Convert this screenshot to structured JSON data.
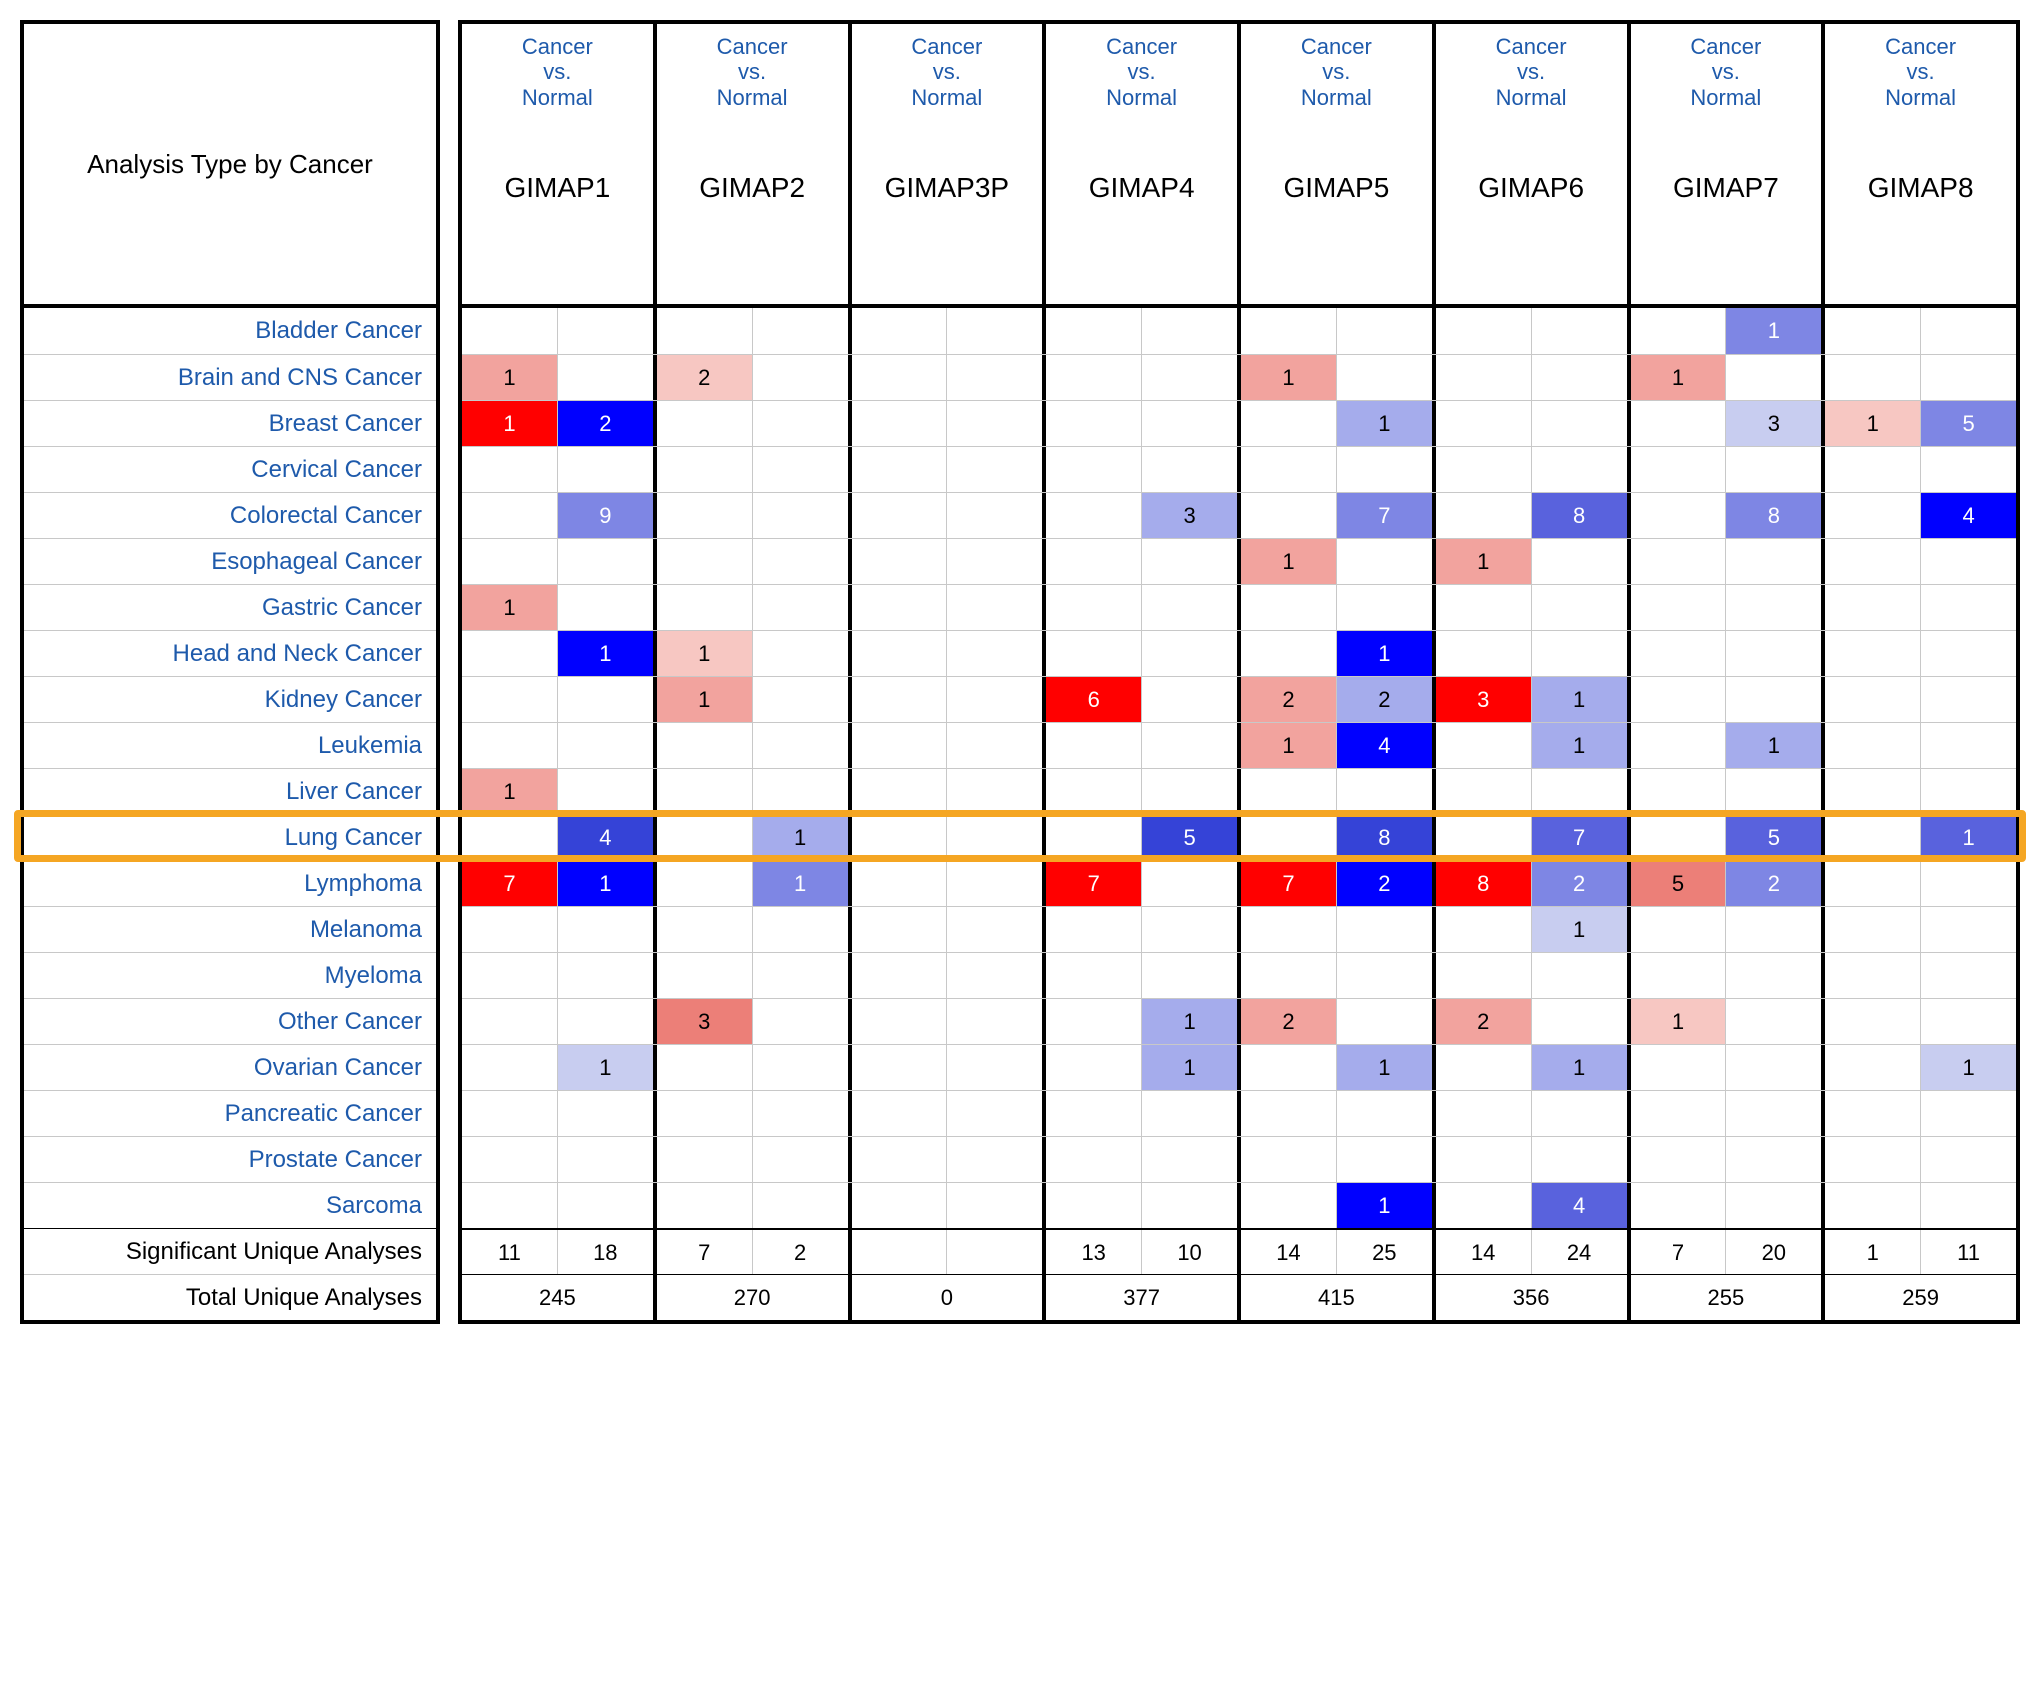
{
  "chart_data": {
    "type": "table",
    "title": "Analysis Type by Cancer",
    "column_header_top": "Cancer vs. Normal",
    "genes": [
      "GIMAP1",
      "GIMAP2",
      "GIMAP3P",
      "GIMAP4",
      "GIMAP5",
      "GIMAP6",
      "GIMAP7",
      "GIMAP8"
    ],
    "cancers": [
      "Bladder Cancer",
      "Brain and CNS Cancer",
      "Breast Cancer",
      "Cervical Cancer",
      "Colorectal Cancer",
      "Esophageal Cancer",
      "Gastric Cancer",
      "Head and Neck Cancer",
      "Kidney Cancer",
      "Leukemia",
      "Liver Cancer",
      "Lung Cancer",
      "Lymphoma",
      "Melanoma",
      "Myeloma",
      "Other Cancer",
      "Ovarian Cancer",
      "Pancreatic Cancer",
      "Prostate Cancer",
      "Sarcoma"
    ],
    "highlight_row": "Lung Cancer",
    "cells": {
      "Bladder Cancer": {
        "GIMAP7": {
          "down": {
            "v": 1,
            "s": 3
          }
        }
      },
      "Brain and CNS Cancer": {
        "GIMAP1": {
          "up": {
            "v": 1,
            "s": 2
          }
        },
        "GIMAP2": {
          "up": {
            "v": 2,
            "s": 1
          }
        },
        "GIMAP5": {
          "up": {
            "v": 1,
            "s": 2
          }
        },
        "GIMAP7": {
          "up": {
            "v": 1,
            "s": 2
          }
        }
      },
      "Breast Cancer": {
        "GIMAP1": {
          "up": {
            "v": 1,
            "s": 6
          },
          "down": {
            "v": 2,
            "s": 6
          }
        },
        "GIMAP5": {
          "down": {
            "v": 1,
            "s": 2
          }
        },
        "GIMAP7": {
          "down": {
            "v": 3,
            "s": 1
          }
        },
        "GIMAP8": {
          "up": {
            "v": 1,
            "s": 1
          },
          "down": {
            "v": 5,
            "s": 3
          }
        }
      },
      "Cervical Cancer": {},
      "Colorectal Cancer": {
        "GIMAP1": {
          "down": {
            "v": 9,
            "s": 3
          }
        },
        "GIMAP4": {
          "down": {
            "v": 3,
            "s": 2
          }
        },
        "GIMAP5": {
          "down": {
            "v": 7,
            "s": 3
          }
        },
        "GIMAP6": {
          "down": {
            "v": 8,
            "s": 4
          }
        },
        "GIMAP7": {
          "down": {
            "v": 8,
            "s": 3
          }
        },
        "GIMAP8": {
          "down": {
            "v": 4,
            "s": 6
          }
        }
      },
      "Esophageal Cancer": {
        "GIMAP5": {
          "up": {
            "v": 1,
            "s": 2
          }
        },
        "GIMAP6": {
          "up": {
            "v": 1,
            "s": 2
          }
        }
      },
      "Gastric Cancer": {
        "GIMAP1": {
          "up": {
            "v": 1,
            "s": 2
          }
        }
      },
      "Head and Neck Cancer": {
        "GIMAP1": {
          "down": {
            "v": 1,
            "s": 6
          }
        },
        "GIMAP2": {
          "up": {
            "v": 1,
            "s": 1
          }
        },
        "GIMAP5": {
          "down": {
            "v": 1,
            "s": 6
          }
        }
      },
      "Kidney Cancer": {
        "GIMAP2": {
          "up": {
            "v": 1,
            "s": 2
          }
        },
        "GIMAP4": {
          "up": {
            "v": 6,
            "s": 6
          }
        },
        "GIMAP5": {
          "up": {
            "v": 2,
            "s": 2
          },
          "down": {
            "v": 2,
            "s": 2
          }
        },
        "GIMAP6": {
          "up": {
            "v": 3,
            "s": 6
          },
          "down": {
            "v": 1,
            "s": 2
          }
        }
      },
      "Leukemia": {
        "GIMAP5": {
          "up": {
            "v": 1,
            "s": 2
          },
          "down": {
            "v": 4,
            "s": 6
          }
        },
        "GIMAP6": {
          "down": {
            "v": 1,
            "s": 2
          }
        },
        "GIMAP7": {
          "down": {
            "v": 1,
            "s": 2
          }
        }
      },
      "Liver Cancer": {
        "GIMAP1": {
          "up": {
            "v": 1,
            "s": 2
          }
        }
      },
      "Lung Cancer": {
        "GIMAP1": {
          "down": {
            "v": 4,
            "s": 5
          }
        },
        "GIMAP2": {
          "down": {
            "v": 1,
            "s": 2
          }
        },
        "GIMAP4": {
          "down": {
            "v": 5,
            "s": 5
          }
        },
        "GIMAP5": {
          "down": {
            "v": 8,
            "s": 5
          }
        },
        "GIMAP6": {
          "down": {
            "v": 7,
            "s": 4
          }
        },
        "GIMAP7": {
          "down": {
            "v": 5,
            "s": 4
          }
        },
        "GIMAP8": {
          "down": {
            "v": 1,
            "s": 4
          }
        }
      },
      "Lymphoma": {
        "GIMAP1": {
          "up": {
            "v": 7,
            "s": 6
          },
          "down": {
            "v": 1,
            "s": 6
          }
        },
        "GIMAP2": {
          "down": {
            "v": 1,
            "s": 3
          }
        },
        "GIMAP4": {
          "up": {
            "v": 7,
            "s": 6
          }
        },
        "GIMAP5": {
          "up": {
            "v": 7,
            "s": 6
          },
          "down": {
            "v": 2,
            "s": 6
          }
        },
        "GIMAP6": {
          "up": {
            "v": 8,
            "s": 6
          },
          "down": {
            "v": 2,
            "s": 3
          }
        },
        "GIMAP7": {
          "up": {
            "v": 5,
            "s": 3
          },
          "down": {
            "v": 2,
            "s": 3
          }
        }
      },
      "Melanoma": {
        "GIMAP6": {
          "down": {
            "v": 1,
            "s": 1
          }
        }
      },
      "Myeloma": {},
      "Other Cancer": {
        "GIMAP2": {
          "up": {
            "v": 3,
            "s": 3
          }
        },
        "GIMAP4": {
          "down": {
            "v": 1,
            "s": 2
          }
        },
        "GIMAP5": {
          "up": {
            "v": 2,
            "s": 2
          }
        },
        "GIMAP6": {
          "up": {
            "v": 2,
            "s": 2
          }
        },
        "GIMAP7": {
          "up": {
            "v": 1,
            "s": 1
          }
        }
      },
      "Ovarian Cancer": {
        "GIMAP1": {
          "down": {
            "v": 1,
            "s": 1
          }
        },
        "GIMAP4": {
          "down": {
            "v": 1,
            "s": 2
          }
        },
        "GIMAP5": {
          "down": {
            "v": 1,
            "s": 2
          }
        },
        "GIMAP6": {
          "down": {
            "v": 1,
            "s": 2
          }
        },
        "GIMAP8": {
          "down": {
            "v": 1,
            "s": 1
          }
        }
      },
      "Pancreatic Cancer": {},
      "Prostate Cancer": {},
      "Sarcoma": {
        "GIMAP5": {
          "down": {
            "v": 1,
            "s": 6
          }
        },
        "GIMAP6": {
          "down": {
            "v": 4,
            "s": 4
          }
        }
      }
    },
    "significant_unique": {
      "GIMAP1": {
        "up": 11,
        "down": 18
      },
      "GIMAP2": {
        "up": 7,
        "down": 2
      },
      "GIMAP3P": {
        "up": "",
        "down": ""
      },
      "GIMAP4": {
        "up": 13,
        "down": 10
      },
      "GIMAP5": {
        "up": 14,
        "down": 25
      },
      "GIMAP6": {
        "up": 14,
        "down": 24
      },
      "GIMAP7": {
        "up": 7,
        "down": 20
      },
      "GIMAP8": {
        "up": 1,
        "down": 11
      }
    },
    "total_unique": {
      "GIMAP1": 245,
      "GIMAP2": 270,
      "GIMAP3P": 0,
      "GIMAP4": 377,
      "GIMAP5": 415,
      "GIMAP6": 356,
      "GIMAP7": 255,
      "GIMAP8": 259
    },
    "row_labels": {
      "sig": "Significant Unique Analyses",
      "tot": "Total Unique Analyses"
    }
  }
}
